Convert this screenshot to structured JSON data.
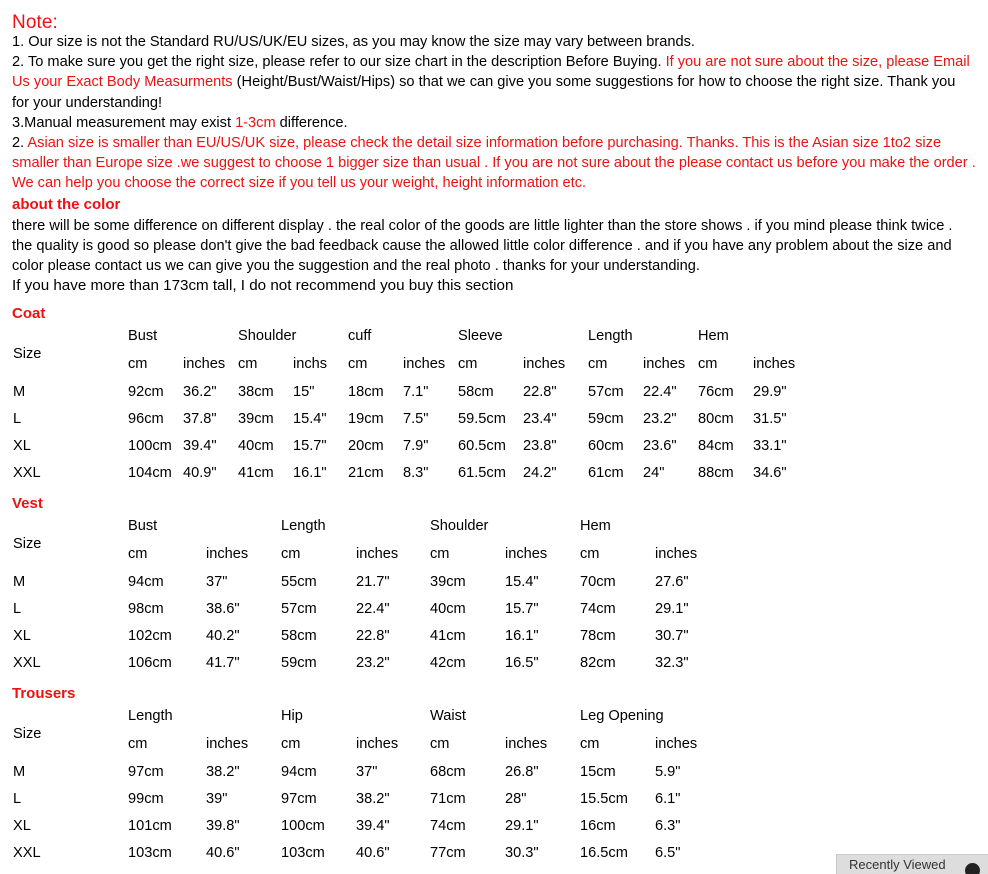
{
  "note": {
    "heading": "Note:",
    "lines": [
      {
        "segments": [
          {
            "text": "1. Our size is not the Standard RU/US/UK/EU sizes, as you may know the size may vary between brands.",
            "color": "black"
          }
        ]
      },
      {
        "segments": [
          {
            "text": "2. To make sure you get the right size, please refer to our size chart in the description Before Buying. ",
            "color": "black"
          },
          {
            "text": "If you are not sure about the size, please Email Us your Exact Body Measurments ",
            "color": "red"
          },
          {
            "text": "(Height/Bust/Waist/Hips) so that we can give you some suggestions for how to choose the right size. Thank you for your understanding!",
            "color": "black"
          }
        ]
      },
      {
        "segments": [
          {
            "text": "3.Manual measurement may exist ",
            "color": "black"
          },
          {
            "text": "1-3cm",
            "color": "red"
          },
          {
            "text": " difference.",
            "color": "black"
          }
        ]
      },
      {
        "segments": [
          {
            "text": "2. ",
            "color": "black"
          },
          {
            "text": "Asian size is smaller than EU/US/UK size, please check the detail size information before purchasing. Thanks. This is the Asian size 1to2 size smaller than Europe size .we suggest to choose 1 bigger    size than usual . If you are not sure about  the please contact us before you make the order . We can help    you choose the correct size if you tell us your weight,  height information etc.",
            "color": "red"
          }
        ]
      }
    ]
  },
  "about_color": {
    "heading": "about the color",
    "body": " there will be some difference on different display . the real color of the goods are little lighter than the store shows . if you mind please think twice . the quality is good so please don't give the bad feedback cause the allowed little color difference . and if you have any problem about the size and color please contact us we can give you the suggestion and the real photo . thanks for your understanding.",
    "height_note": "If you have more than 173cm tall, I do not recommend you buy this section"
  },
  "tables": {
    "coat": {
      "title": "Coat",
      "size_label": "Size",
      "groups": [
        "Bust",
        "Shoulder",
        "cuff",
        "Sleeve",
        "Length",
        "Hem"
      ],
      "units": [
        "cm",
        "inches",
        "cm",
        "inchs",
        "cm",
        "inches",
        "cm",
        "inches",
        "cm",
        "inches",
        "cm",
        "inches"
      ],
      "rows": [
        {
          "size": "M",
          "values": [
            "92cm",
            "36.2\"",
            "38cm",
            "15\"",
            "18cm",
            "7.1\"",
            "58cm",
            "22.8\"",
            "57cm",
            "22.4\"",
            "76cm",
            "29.9\""
          ]
        },
        {
          "size": "L",
          "values": [
            "96cm",
            "37.8\"",
            "39cm",
            "15.4\"",
            "19cm",
            "7.5\"",
            "59.5cm",
            "23.4\"",
            "59cm",
            "23.2\"",
            "80cm",
            "31.5\""
          ]
        },
        {
          "size": "XL",
          "values": [
            "100cm",
            "39.4\"",
            "40cm",
            "15.7\"",
            "20cm",
            "7.9\"",
            "60.5cm",
            "23.8\"",
            "60cm",
            "23.6\"",
            "84cm",
            "33.1\""
          ]
        },
        {
          "size": "XXL",
          "values": [
            "104cm",
            "40.9\"",
            "41cm",
            "16.1\"",
            "21cm",
            "8.3\"",
            "61.5cm",
            "24.2\"",
            "61cm",
            "24\"",
            "88cm",
            "34.6\""
          ]
        }
      ]
    },
    "vest": {
      "title": "Vest",
      "size_label": "Size",
      "groups": [
        "Bust",
        "Length",
        "Shoulder",
        "Hem"
      ],
      "units": [
        "cm",
        "inches",
        "cm",
        "inches",
        "cm",
        "inches",
        "cm",
        "inches"
      ],
      "rows": [
        {
          "size": "M",
          "values": [
            "94cm",
            "37\"",
            "55cm",
            "21.7\"",
            "39cm",
            "15.4\"",
            "70cm",
            "27.6\""
          ]
        },
        {
          "size": "L",
          "values": [
            "98cm",
            "38.6\"",
            "57cm",
            "22.4\"",
            "40cm",
            "15.7\"",
            "74cm",
            "29.1\""
          ]
        },
        {
          "size": "XL",
          "values": [
            "102cm",
            "40.2\"",
            "58cm",
            "22.8\"",
            "41cm",
            "16.1\"",
            "78cm",
            "30.7\""
          ]
        },
        {
          "size": "XXL",
          "values": [
            "106cm",
            "41.7\"",
            "59cm",
            "23.2\"",
            "42cm",
            "16.5\"",
            "82cm",
            "32.3\""
          ]
        }
      ]
    },
    "trousers": {
      "title": "Trousers",
      "size_label": "Size",
      "groups": [
        "Length",
        "Hip",
        "Waist",
        "Leg Opening"
      ],
      "units": [
        "cm",
        "inches",
        "cm",
        "inches",
        "cm",
        "inches",
        "cm",
        "inches"
      ],
      "rows": [
        {
          "size": "M",
          "values": [
            "97cm",
            "38.2\"",
            "94cm",
            "37\"",
            "68cm",
            "26.8\"",
            "15cm",
            "5.9\""
          ]
        },
        {
          "size": "L",
          "values": [
            "99cm",
            "39\"",
            "97cm",
            "38.2\"",
            "71cm",
            "28\"",
            "15.5cm",
            "6.1\""
          ]
        },
        {
          "size": "XL",
          "values": [
            "101cm",
            "39.8\"",
            "100cm",
            "39.4\"",
            "74cm",
            "29.1\"",
            "16cm",
            "6.3\""
          ]
        },
        {
          "size": "XXL",
          "values": [
            "103cm",
            "40.6\"",
            "103cm",
            "40.6\"",
            "77cm",
            "30.3\"",
            "16.5cm",
            "6.5\""
          ]
        }
      ]
    }
  },
  "recently_viewed": {
    "label": "Recently Viewed",
    "icon": "chevron-circle-icon"
  },
  "colors": {
    "red": "#ee1111",
    "black": "#000000",
    "widget_bg": "#dddddd"
  }
}
